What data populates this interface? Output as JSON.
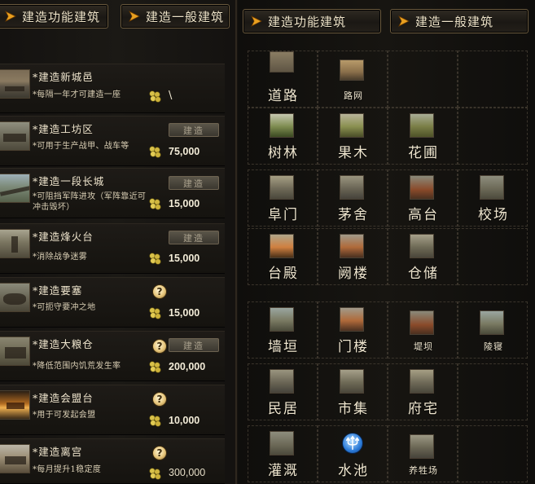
{
  "left": {
    "tabs": [
      {
        "label": "建造功能建筑"
      },
      {
        "label": "建造一般建筑"
      }
    ],
    "rows": [
      {
        "title": "*建造新城邑",
        "desc": "*每隔一年才可建造一座",
        "cost": "\\",
        "has_build_button": false,
        "has_help": false
      },
      {
        "title": "*建造工坊区",
        "desc": "*可用于生产战甲、战车等",
        "cost": "75,000",
        "build_label": "建造",
        "has_build_button": true,
        "has_help": false
      },
      {
        "title": "*建造一段长城",
        "desc": "*可阻挡军阵进攻（军阵靠近可冲击毁坏）",
        "cost": "15,000",
        "build_label": "建造",
        "has_build_button": true,
        "has_help": false
      },
      {
        "title": "*建造烽火台",
        "desc": "*消除战争迷雾",
        "cost": "15,000",
        "build_label": "建造",
        "has_build_button": true,
        "has_help": false
      },
      {
        "title": "*建造要塞",
        "desc": "*可扼守要冲之地",
        "cost": "15,000",
        "help": "?",
        "has_build_button": false,
        "has_help": true
      },
      {
        "title": "*建造大粮仓",
        "desc": "*降低范围内饥荒发生率",
        "cost": "200,000",
        "build_label": "建造",
        "help": "?",
        "has_build_button": true,
        "has_help": true
      },
      {
        "title": "*建造会盟台",
        "desc": "*用于可发起会盟",
        "cost": "10,000",
        "help": "?",
        "has_build_button": false,
        "has_help": true
      },
      {
        "title": "*建造离宫",
        "desc": "*每月提升1稳定度",
        "cost": "300,000",
        "help": "?",
        "has_build_button": false,
        "has_help": true
      }
    ]
  },
  "right": {
    "tabs": [
      {
        "label": "建造功能建筑"
      },
      {
        "label": "建造一般建筑"
      }
    ],
    "cells": [
      {
        "label": "道路",
        "size": "large",
        "pic": "road"
      },
      {
        "label": "路网",
        "size": "small",
        "pic": "road-network"
      },
      {
        "label": "树林",
        "size": "large",
        "pic": "woods"
      },
      {
        "label": "果木",
        "size": "large",
        "pic": "orchard"
      },
      {
        "label": "花圃",
        "size": "large",
        "pic": "flower-garden"
      },
      {
        "label": "阜门",
        "size": "large",
        "pic": "city-gate"
      },
      {
        "label": "茅舍",
        "size": "large",
        "pic": "thatched-cottage"
      },
      {
        "label": "高台",
        "size": "large",
        "pic": "terrace"
      },
      {
        "label": "校场",
        "size": "large",
        "pic": "drill-ground"
      },
      {
        "label": "台殿",
        "size": "large",
        "pic": "terrace-hall"
      },
      {
        "label": "阙楼",
        "size": "large",
        "pic": "watchtower"
      },
      {
        "label": "仓储",
        "size": "large",
        "pic": "storehouse"
      },
      {
        "label": "墙垣",
        "size": "large",
        "pic": "wall"
      },
      {
        "label": "门楼",
        "size": "large",
        "pic": "gate-tower"
      },
      {
        "label": "堤坝",
        "size": "small",
        "pic": "dam"
      },
      {
        "label": "陵寝",
        "size": "small",
        "pic": "mausoleum"
      },
      {
        "label": "民居",
        "size": "large",
        "pic": "dwelling"
      },
      {
        "label": "市集",
        "size": "large",
        "pic": "market"
      },
      {
        "label": "府宅",
        "size": "large",
        "pic": "mansion"
      },
      {
        "label": "灌溉",
        "size": "large",
        "pic": "irrigation"
      },
      {
        "label": "水池",
        "size": "large",
        "pic": "water-pool"
      },
      {
        "label": "养牲场",
        "size": "small",
        "pic": "livestock-farm"
      }
    ]
  }
}
